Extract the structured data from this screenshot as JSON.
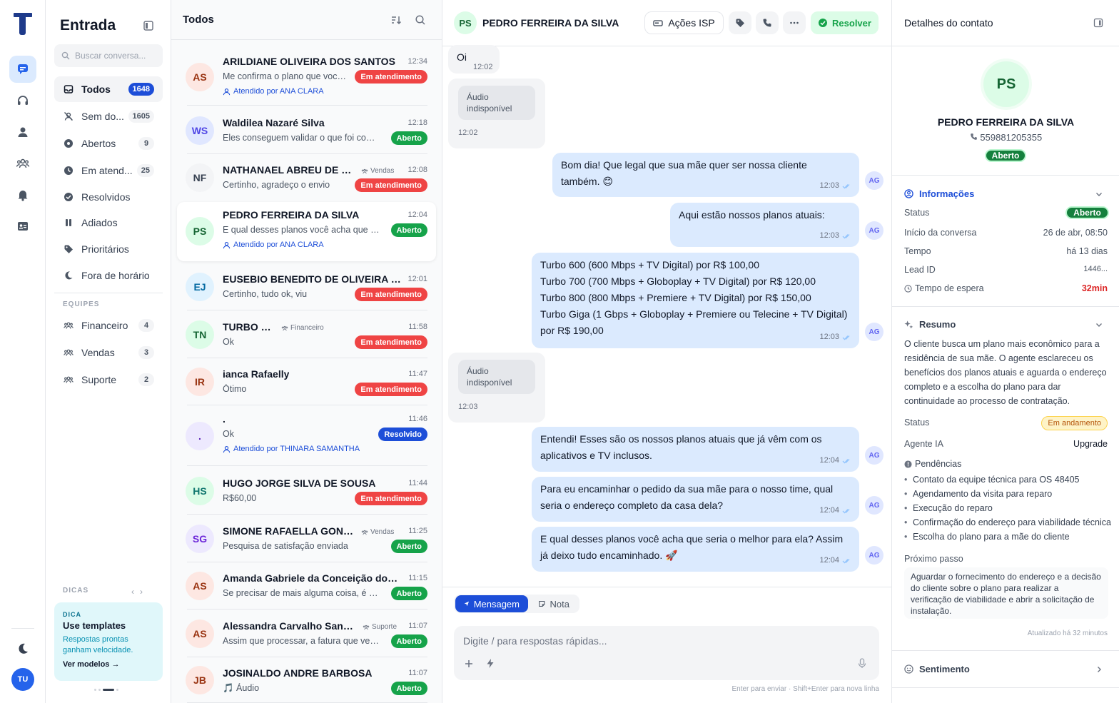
{
  "rail": {
    "icons": [
      "chat-icon",
      "headset-icon",
      "user-icon",
      "team-icon",
      "bell-icon",
      "contact-card-icon",
      "moon-icon"
    ],
    "user_initials": "TU"
  },
  "sidebar": {
    "title": "Entrada",
    "search_placeholder": "Buscar conversa...",
    "items": [
      {
        "label": "Todos",
        "count": "1648",
        "icon": "inbox-icon",
        "active": true
      },
      {
        "label": "Sem do...",
        "count": "1605",
        "icon": "unassigned-icon"
      },
      {
        "label": "Abertos",
        "count": "9",
        "icon": "open-icon"
      },
      {
        "label": "Em atend...",
        "count": "25",
        "icon": "clock-icon"
      },
      {
        "label": "Resolvidos",
        "count": "",
        "icon": "check-circle-icon"
      },
      {
        "label": "Adiados",
        "count": "",
        "icon": "pause-icon"
      },
      {
        "label": "Prioritários",
        "count": "",
        "icon": "tag-icon"
      },
      {
        "label": "Fora de horário",
        "count": "",
        "icon": "moon-icon"
      }
    ],
    "teams_label": "EQUIPES",
    "teams": [
      {
        "label": "Financeiro",
        "count": "4"
      },
      {
        "label": "Vendas",
        "count": "3"
      },
      {
        "label": "Suporte",
        "count": "2"
      }
    ],
    "tips_label": "DICAS",
    "tip": {
      "kicker": "DICA",
      "title": "Use templates",
      "body": "Respostas prontas ganham velocidade.",
      "link": "Ver modelos →"
    }
  },
  "list": {
    "title": "Todos",
    "conversations": [
      {
        "initials": "AS",
        "name": "ARILDIANE OLIVEIRA DOS SANTOS",
        "time": "12:34",
        "preview": "Me confirma o plano que voce ...",
        "status": "Em atendimento",
        "agent": "Atendido por ANA CLARA",
        "team": ""
      },
      {
        "initials": "WS",
        "name": "Waldilea Nazaré Silva",
        "time": "12:18",
        "preview": "Eles conseguem validar o que foi combi...",
        "status": "Aberto",
        "agent": "",
        "team": ""
      },
      {
        "initials": "NF",
        "name": "NATHANAEL ABREU DE SO...",
        "time": "12:08",
        "preview": "Certinho, agradeço o envio",
        "status": "Em atendimento",
        "agent": "",
        "team": "Vendas"
      },
      {
        "initials": "PS",
        "name": "PEDRO FERREIRA DA SILVA",
        "time": "12:04",
        "preview": "E qual desses planos você acha que seri...",
        "status": "Aberto",
        "agent": "Atendido por ANA CLARA",
        "team": ""
      },
      {
        "initials": "EJ",
        "name": "EUSEBIO BENEDITO DE OLIVEIRA JUN...",
        "time": "12:01",
        "preview": "Certinho, tudo ok, viu",
        "status": "Em atendimento",
        "agent": "",
        "team": ""
      },
      {
        "initials": "TN",
        "name": "TURBO NET",
        "time": "11:58",
        "preview": "Ok",
        "status": "Em atendimento",
        "agent": "",
        "team": "Financeiro"
      },
      {
        "initials": "IR",
        "name": "ianca Rafaelly",
        "time": "11:47",
        "preview": "Ótimo",
        "status": "Em atendimento",
        "agent": "",
        "team": ""
      },
      {
        "initials": ".",
        "name": ".",
        "time": "11:46",
        "preview": "Ok",
        "status": "Resolvido",
        "agent": "Atendido por THINARA SAMANTHA",
        "team": ""
      },
      {
        "initials": "HS",
        "name": "HUGO JORGE SILVA DE SOUSA",
        "time": "11:44",
        "preview": "R$60,00",
        "status": "Em atendimento",
        "agent": "",
        "team": ""
      },
      {
        "initials": "SG",
        "name": "SIMONE RAFAELLA GONÇA...",
        "time": "11:25",
        "preview": "Pesquisa de satisfação enviada",
        "status": "Aberto",
        "agent": "",
        "team": "Vendas"
      },
      {
        "initials": "AS",
        "name": "Amanda Gabriele da Conceição dos S...",
        "time": "11:15",
        "preview": "Se precisar de mais alguma coisa, é só ...",
        "status": "Aberto",
        "agent": "",
        "team": ""
      },
      {
        "initials": "AS",
        "name": "Alessandra Carvalho Santi...",
        "time": "11:07",
        "preview": "Assim que processar, a fatura que venc...",
        "status": "Aberto",
        "agent": "",
        "team": "Suporte"
      },
      {
        "initials": "JB",
        "name": "JOSINALDO ANDRE BARBOSA",
        "time": "11:07",
        "preview": "Áudio",
        "status": "Aberto",
        "agent": "",
        "team": ""
      }
    ]
  },
  "chat": {
    "initials": "PS",
    "name": "PEDRO FERREIRA DA SILVA",
    "isp_label": "Ações ISP",
    "resolve_label": "Resolver",
    "messages": [
      {
        "dir": "in",
        "text": "Oi",
        "time": "12:02"
      },
      {
        "dir": "in",
        "audio": "Áudio indisponível",
        "time": "12:02"
      },
      {
        "dir": "out",
        "lines": [
          "Bom dia! Que legal que sua mãe quer ser nossa cliente",
          "também. 😊"
        ],
        "time": "12:03",
        "agent": "AG"
      },
      {
        "dir": "out",
        "lines": [
          "Aqui estão nossos planos atuais:"
        ],
        "time": "12:03",
        "agent": "AG"
      },
      {
        "dir": "out",
        "lines": [
          "Turbo 600 (600 Mbps + TV Digital) por R$ 100,00",
          "Turbo 700 (700 Mbps + Globoplay + TV Digital) por R$ 120,00",
          "Turbo 800 (800 Mbps + Premiere + TV Digital) por R$ 150,00",
          "Turbo Giga (1 Gbps + Globoplay + Premiere ou Telecine + TV Digital)",
          "por R$ 190,00"
        ],
        "time": "12:03",
        "agent": "AG"
      },
      {
        "dir": "in",
        "audio": "Áudio indisponível",
        "time": "12:03"
      },
      {
        "dir": "out",
        "lines": [
          "Entendi! Esses são os nossos planos atuais que já vêm com os",
          "aplicativos e TV inclusos."
        ],
        "time": "12:04",
        "agent": "AG"
      },
      {
        "dir": "out",
        "lines": [
          "Para eu encaminhar o pedido da sua mãe para o nosso time, qual",
          "seria o endereço completo da casa dela?"
        ],
        "time": "12:04",
        "agent": "AG"
      },
      {
        "dir": "out",
        "lines": [
          "E qual desses planos você acha que seria o melhor para ela? Assim",
          "já deixo tudo encaminhado. 🚀"
        ],
        "time": "12:04",
        "agent": "AG"
      }
    ],
    "tab_message": "Mensagem",
    "tab_note": "Nota",
    "input_placeholder": "Digite / para respostas rápidas...",
    "hint": "Enter para enviar · Shift+Enter para nova linha"
  },
  "details": {
    "title": "Detalhes do contato",
    "initials": "PS",
    "name": "PEDRO FERREIRA DA SILVA",
    "phone": "559881205355",
    "status": "Aberto",
    "info_title": "Informações",
    "info": [
      {
        "label": "Status",
        "value": "Aberto"
      },
      {
        "label": "Início da conversa",
        "value": "26 de abr, 08:50"
      },
      {
        "label": "Tempo",
        "value": "há 13 dias"
      },
      {
        "label": "Lead ID",
        "value": "1446..."
      },
      {
        "label": "Tempo de espera",
        "value": "32min"
      }
    ],
    "summary_title": "Resumo",
    "summary": "O cliente busca um plano mais econômico para a residência de sua mãe. O agente esclareceu os benefícios dos planos atuais e aguarda o endereço completo e a escolha do plano para dar continuidade ao processo de contratação.",
    "summary_status_label": "Status",
    "summary_status": "Em andamento",
    "agent_label": "Agente IA",
    "agent_value": "Upgrade",
    "pending_title": "Pendências",
    "pending": [
      "Contato da equipe técnica para OS 48405",
      "Agendamento da visita para reparo",
      "Execução do reparo",
      "Confirmação do endereço para viabilidade técnica",
      "Escolha do plano para a mãe do cliente"
    ],
    "next_title": "Próximo passo",
    "next": "Aguardar o fornecimento do endereço e a decisão do cliente sobre o plano para realizar a verificação de viabilidade e abrir a solicitação de instalação.",
    "updated": "Atualizado há 32 minutos",
    "sentiment_title": "Sentimento",
    "colors": {
      "accent": "#1d4ed8",
      "green": "#16a34a",
      "red": "#ef4444",
      "bubble_out": "#dbeafe"
    }
  }
}
